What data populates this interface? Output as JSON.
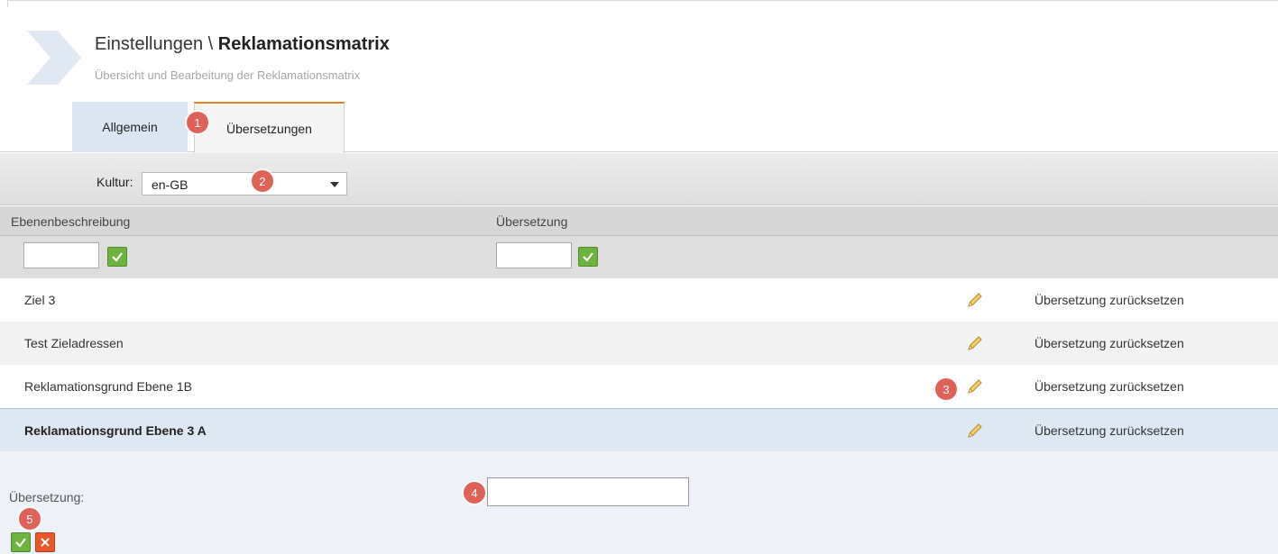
{
  "header": {
    "breadcrumb_parent": "Einstellungen",
    "breadcrumb_sep": " \\ ",
    "breadcrumb_current": "Reklamationsmatrix",
    "subtitle": "Übersicht und Bearbeitung der Reklamationsmatrix"
  },
  "tabs": [
    {
      "label": "Allgemein",
      "active": false
    },
    {
      "label": "Übersetzungen",
      "active": true
    }
  ],
  "toolbar": {
    "kultur_label": "Kultur:",
    "kultur_value": "en-GB"
  },
  "grid": {
    "columns": [
      "Ebenenbeschreibung",
      "Übersetzung"
    ],
    "rows": [
      {
        "description": "Ziel 3",
        "reset_label": "Übersetzung zurücksetzen"
      },
      {
        "description": "Test Zieladressen",
        "reset_label": "Übersetzung zurücksetzen"
      },
      {
        "description": "Reklamationsgrund Ebene 1B",
        "reset_label": "Übersetzung zurücksetzen"
      },
      {
        "description": "Reklamationsgrund Ebene 3 A",
        "reset_label": "Übersetzung zurücksetzen",
        "selected": true
      }
    ]
  },
  "edit_panel": {
    "label": "Übersetzung:",
    "value": ""
  },
  "badges": [
    "1",
    "2",
    "3",
    "4",
    "5"
  ],
  "colors": {
    "accent_orange": "#e67e22",
    "badge_red": "#e06156",
    "confirm_green": "#6cb33f",
    "cancel_orange": "#e8572a",
    "selected_row": "#dde8f3"
  }
}
